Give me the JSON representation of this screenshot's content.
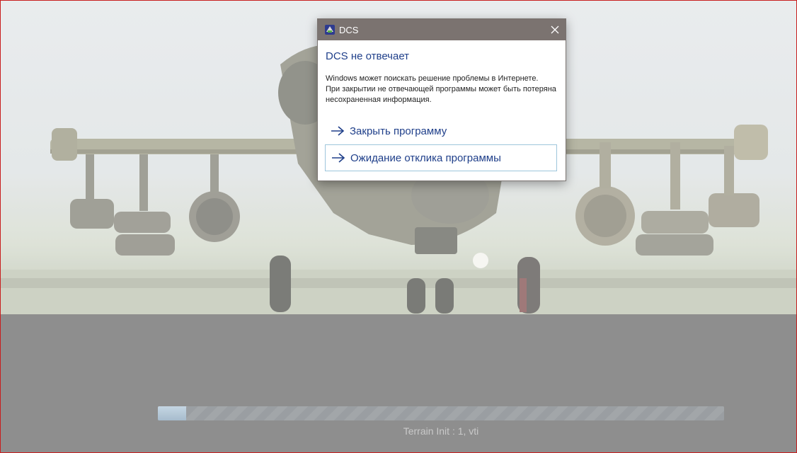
{
  "dialog": {
    "title": "DCS",
    "heading": "DCS не отвечает",
    "message": "Windows может поискать решение проблемы в Интернете.\nПри закрытии не отвечающей программы может быть потеряна несохраненная информация.",
    "options": [
      {
        "label": "Закрыть программу"
      },
      {
        "label": "Ожидание отклика программы"
      }
    ],
    "icons": {
      "app": "dcs-app-icon",
      "close": "close-icon",
      "option": "arrow-right-icon"
    },
    "colors": {
      "titlebar": "#7b7370",
      "link": "#1f3f8a",
      "focus_border": "#9ec6dc"
    }
  },
  "loading": {
    "progress": 0.05,
    "status": "Terrain Init : 1, vti"
  },
  "colors": {
    "window_border": "#c81e1e",
    "overlay": "#8e8e8e"
  }
}
